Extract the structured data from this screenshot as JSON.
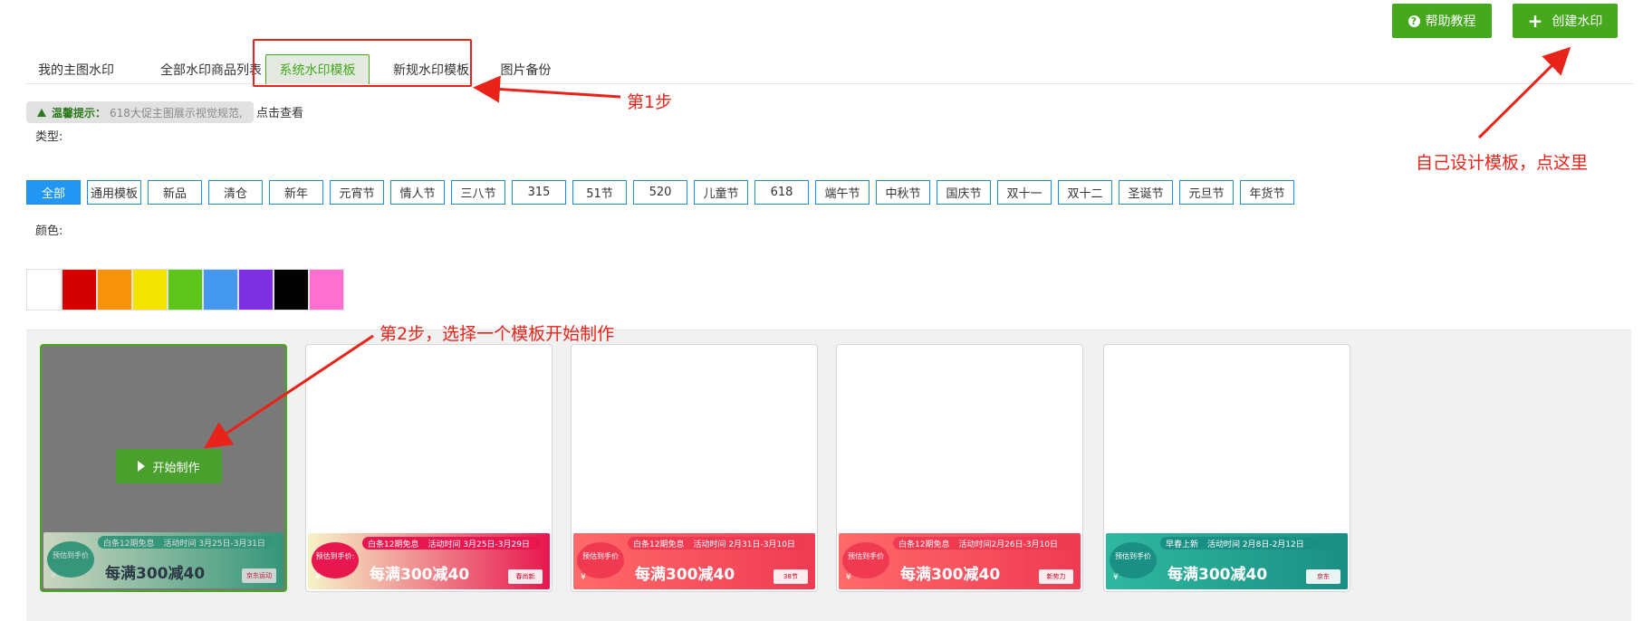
{
  "header": {
    "help_label": "帮助教程",
    "create_label": "创建水印"
  },
  "tabs": [
    {
      "label": "我的主图水印"
    },
    {
      "label": "全部水印商品列表"
    },
    {
      "label": "系统水印模板",
      "active": true
    },
    {
      "label": "新规水印模板"
    },
    {
      "label": "图片备份"
    }
  ],
  "tip": {
    "title": "温馨提示：",
    "text": "618大促主图展示视觉规范,",
    "link": "点击查看"
  },
  "filters": {
    "type_label": "类型:",
    "color_label": "颜色:",
    "types": [
      "全部",
      "通用模板",
      "新品",
      "清仓",
      "新年",
      "元宵节",
      "情人节",
      "三八节",
      "315",
      "51节",
      "520",
      "儿童节",
      "618",
      "端午节",
      "中秋节",
      "国庆节",
      "双十一",
      "双十二",
      "圣诞节",
      "元旦节",
      "年货节"
    ],
    "active_type": "全部",
    "colors": [
      "#ffffff",
      "#d40000",
      "#f7920a",
      "#f2e400",
      "#5ec51b",
      "#4499ee",
      "#7b2fe0",
      "#000000",
      "#ff6fd0"
    ]
  },
  "cards": [
    {
      "top": "白条12期免息",
      "time": "活动时间 3月25日-3月31日",
      "pre": "预估到手价",
      "main": "每满300减40",
      "logo": "京东运动",
      "theme": "#1fa07a",
      "bg": "#e8f5d8"
    },
    {
      "top": "白条12期免息",
      "time": "活动时间 3月25日-3月29日",
      "pre": "预估到手价:",
      "main": "每满300减40",
      "logo": "春尚新",
      "theme": "#e8174f",
      "bg": "#f6f3c8"
    },
    {
      "top": "白条12期免息",
      "time": "活动时间 2月31日-3月10日",
      "pre": "预估到手价",
      "main": "每满300减40",
      "logo": "38节",
      "theme": "#f03a52",
      "bg": "#ff6a6a"
    },
    {
      "top": "白条12期免息",
      "time": "活动时间2月26日-3月10日",
      "pre": "预估到手价",
      "main": "每满300减40",
      "logo": "新势力",
      "theme": "#f03a52",
      "bg": "#ff6a6a"
    },
    {
      "top": "早春上新",
      "time": "活动时间 2月8日-2月12日",
      "pre": "预估到手价",
      "main": "每满300减40",
      "logo": "京东",
      "theme": "#1a8f83",
      "bg": "#2fb8a0"
    }
  ],
  "start_label": "开始制作",
  "annotations": {
    "step1": "第1步",
    "step2": "第2步，选择一个模板开始制作",
    "self_design": "自己设计模板，点这里"
  },
  "colors": {
    "accent": "#45a81d",
    "link": "#1e88e5",
    "annotation": "#e8241a"
  }
}
